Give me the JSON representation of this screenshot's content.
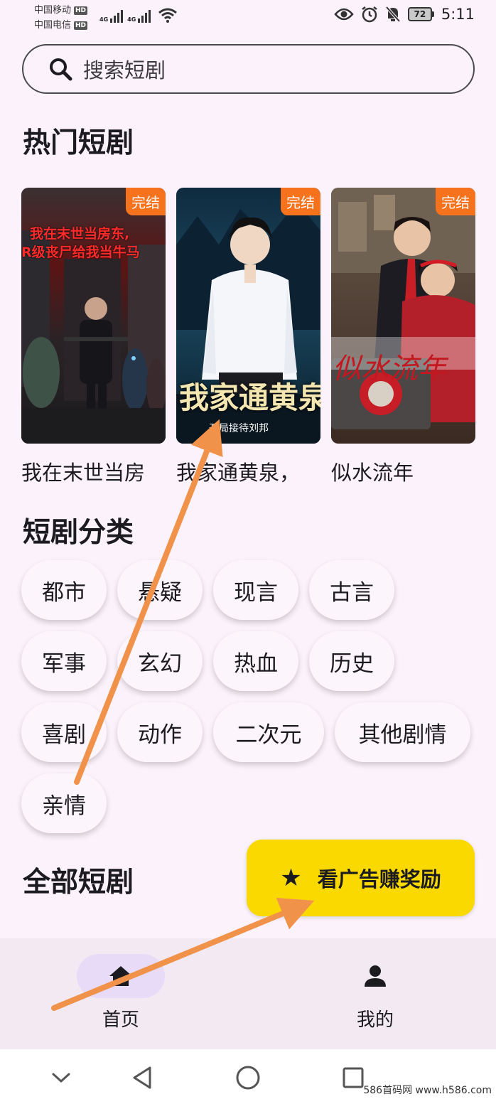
{
  "status_bar": {
    "carrier1": "中国移动",
    "carrier2": "中国电信",
    "hd": "HD",
    "net": "4G",
    "battery": "72",
    "time": "5:11"
  },
  "search": {
    "placeholder": "搜索短剧"
  },
  "hot": {
    "title": "热门短剧",
    "items": [
      {
        "title": "我在末世当房",
        "badge": "完结",
        "poster_text_1": "我在末世当房东,",
        "poster_text_2": "R级丧尸给我当牛马"
      },
      {
        "title": "我家通黄泉，",
        "badge": "完结",
        "poster_text_1": "我家通黄泉",
        "poster_text_2": "开局接待刘邦"
      },
      {
        "title": "似水流年",
        "badge": "完结",
        "poster_text_1": "似水流年",
        "poster_text_2": ""
      }
    ]
  },
  "categories": {
    "title": "短剧分类",
    "items": [
      "都市",
      "悬疑",
      "现言",
      "古言",
      "军事",
      "玄幻",
      "热血",
      "历史",
      "喜剧",
      "动作",
      "二次元",
      "其他剧情",
      "亲情"
    ]
  },
  "all": {
    "title": "全部短剧"
  },
  "fab": {
    "label": "看广告赚奖励",
    "icon": "star-icon"
  },
  "bottom_nav": {
    "items": [
      {
        "label": "首页",
        "icon": "home-icon",
        "active": true
      },
      {
        "label": "我的",
        "icon": "person-icon",
        "active": false
      }
    ]
  },
  "watermark": "586首码网 www.h586.com",
  "colors": {
    "background": "#fcf2fb",
    "badge": "#f6721c",
    "fab": "#f9d900",
    "nav_active": "#e7dbf8",
    "annotation_arrow": "#f0924a"
  }
}
